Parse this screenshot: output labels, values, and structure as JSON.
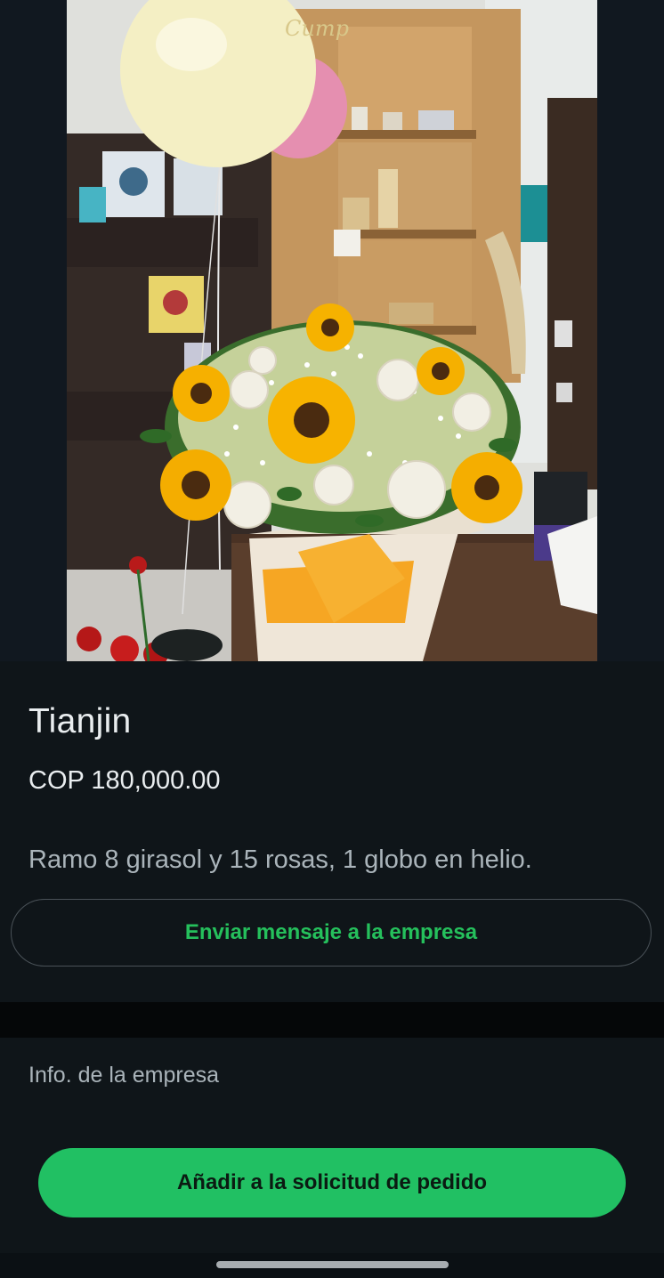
{
  "product": {
    "title": "Tianjin",
    "price": "COP 180,000.00",
    "description": "Ramo 8 girasol y 15 rosas, 1 globo en helio.",
    "image_alt": "Bouquet of sunflowers, white roses and baby's breath with a helium balloon"
  },
  "actions": {
    "message_label": "Enviar mensaje a la empresa",
    "add_label": "Añadir a la solicitud de pedido"
  },
  "company": {
    "info_label": "Info. de la empresa"
  },
  "colors": {
    "background": "#0f1519",
    "accent_green": "#21c063",
    "text_primary": "#e9edef",
    "text_secondary": "#aab4ba"
  }
}
